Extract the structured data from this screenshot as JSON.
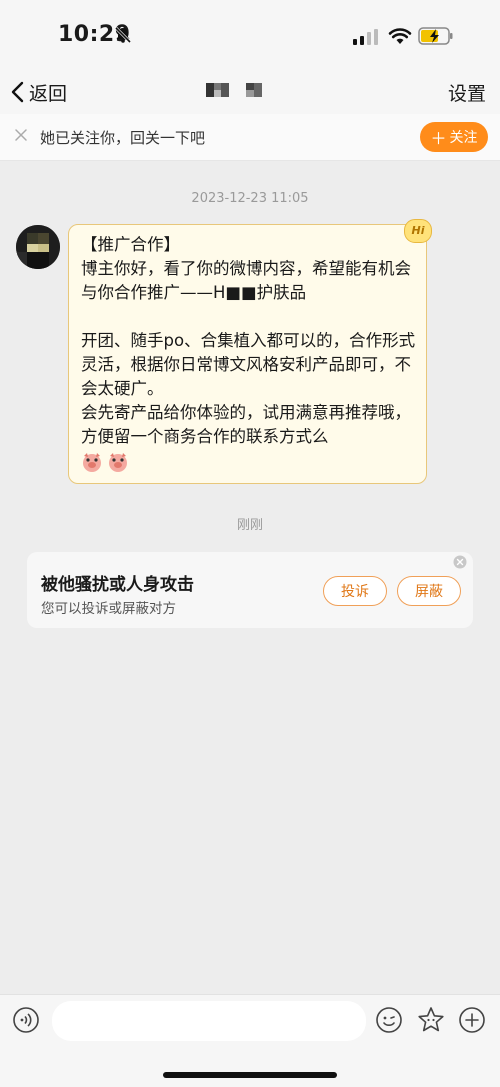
{
  "status_bar": {
    "time": "10:29"
  },
  "nav": {
    "back_label": "返回",
    "settings_label": "设置"
  },
  "follow_bar": {
    "text": "她已关注你，回关一下吧",
    "follow_button": "关注"
  },
  "chat": {
    "timestamp": "2023-12-23 11:05",
    "message": {
      "badge": "Hi",
      "lines": [
        "【推广合作】",
        "博主你好，看了你的微博内容，希望能有机会与你合作推广——H■■护肤品",
        "",
        "开团、随手po、合集植入都可以的，合作形式灵活，根据你日常博文风格安利产品即可，不会太硬广。",
        "会先寄产品给你体验的，试用满意再推荐哦，方便留一个商务合作的联系方式么"
      ]
    },
    "just_now": "刚刚"
  },
  "report_card": {
    "title": "被他骚扰或人身攻击",
    "subtitle": "您可以投诉或屏蔽对方",
    "complain_button": "投诉",
    "block_button": "屏蔽"
  },
  "colors": {
    "accent": "#ff8c1a",
    "bubble_bg": "#fffbea",
    "bubble_border": "#e8c77a"
  }
}
